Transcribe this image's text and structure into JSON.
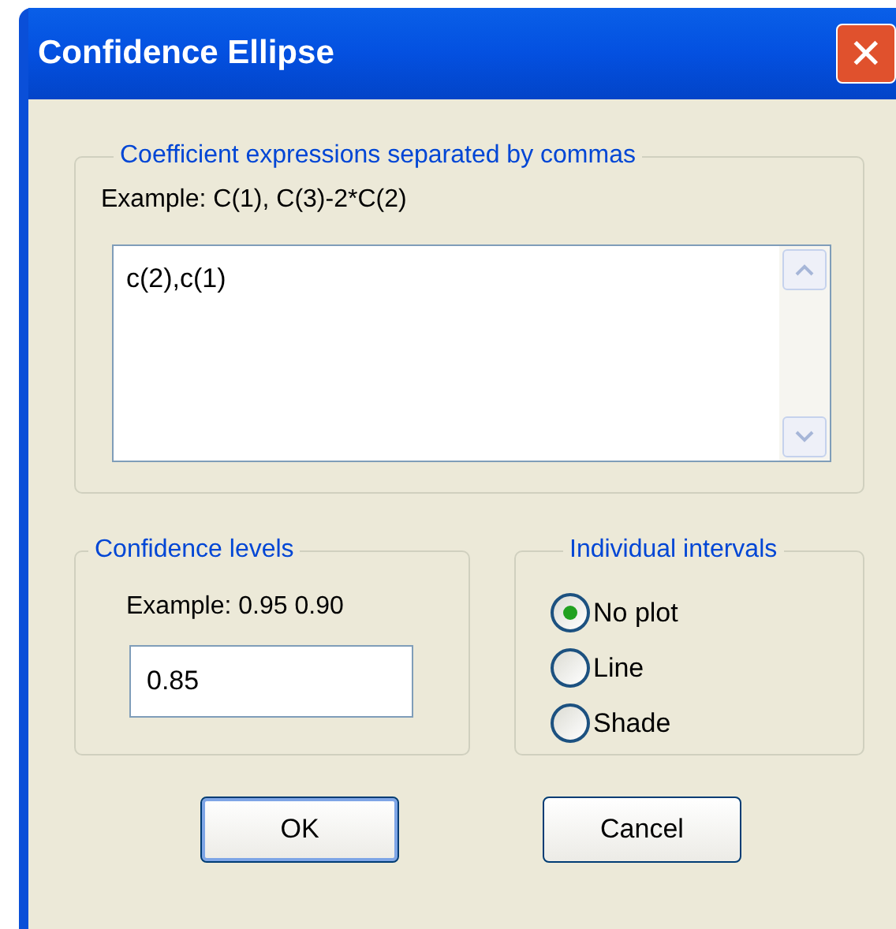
{
  "window": {
    "title": "Confidence Ellipse",
    "close": "✕"
  },
  "coefficients": {
    "legend": "Coefficient expressions separated by commas",
    "example": "Example: C(1),  C(3)-2*C(2)",
    "value": "c(2),c(1)"
  },
  "confidence": {
    "legend": "Confidence levels",
    "example": "Example: 0.95 0.90",
    "value": "0.85"
  },
  "intervals": {
    "legend": "Individual intervals",
    "options": [
      {
        "label": "No plot",
        "selected": true
      },
      {
        "label": "Line",
        "selected": false
      },
      {
        "label": "Shade",
        "selected": false
      }
    ]
  },
  "buttons": [
    {
      "label": "OK",
      "default": true
    },
    {
      "label": "Cancel",
      "default": false
    }
  ]
}
